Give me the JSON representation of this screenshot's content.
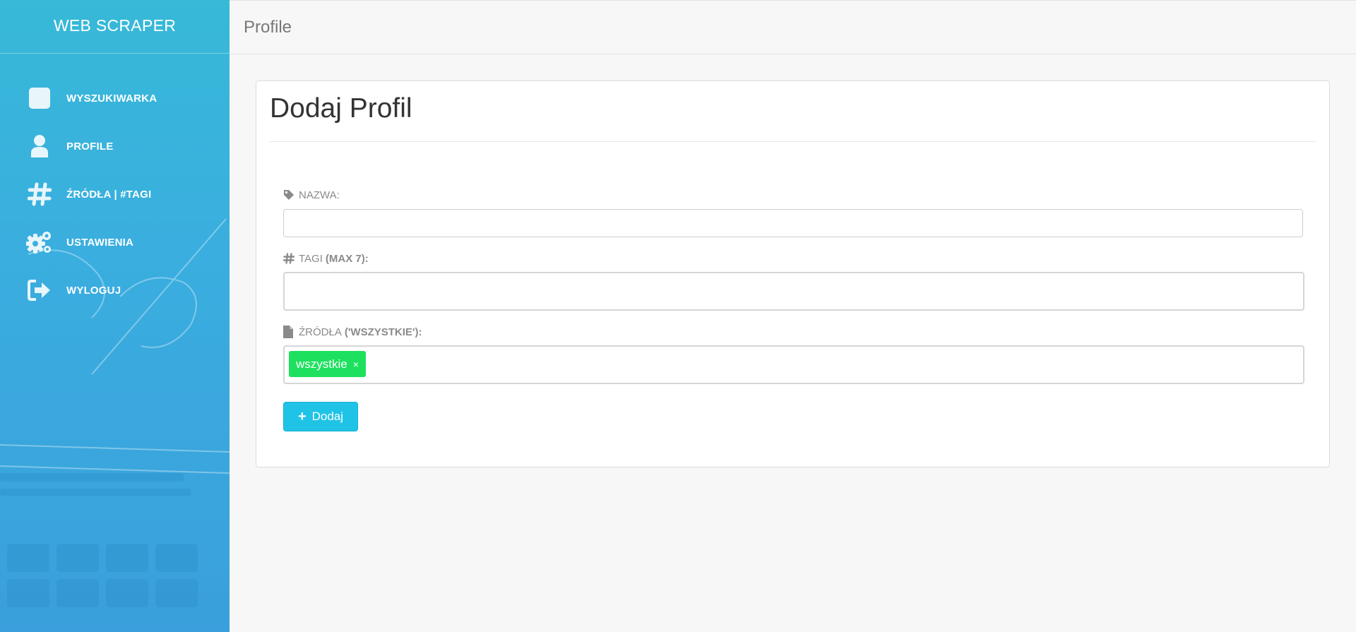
{
  "sidebar": {
    "brand": "WEB SCRAPER",
    "items": [
      {
        "label": "WYSZUKIWARKA",
        "icon": "square-icon"
      },
      {
        "label": "PROFILE",
        "icon": "user-icon"
      },
      {
        "label": "ŹRÓDŁA | #TAGI",
        "icon": "hash-icon"
      },
      {
        "label": "USTAWIENIA",
        "icon": "gears-icon"
      },
      {
        "label": "WYLOGUJ",
        "icon": "logout-icon"
      }
    ]
  },
  "header": {
    "title": "Profile"
  },
  "card": {
    "title": "Dodaj Profil",
    "fields": {
      "name": {
        "label": "NAZWA:",
        "icon": "tag-icon",
        "value": ""
      },
      "tags": {
        "label": "TAGI",
        "label_bold": "(MAX 7):",
        "icon": "hash-icon",
        "value": ""
      },
      "sources": {
        "label": "ŹRÓDŁA",
        "label_bold": "('WSZYSTKIE'):",
        "icon": "file-icon",
        "chips": [
          "wszystkie"
        ],
        "chip_remove": "×"
      }
    },
    "submit": {
      "icon": "+",
      "label": "Dodaj"
    }
  },
  "colors": {
    "sidebar": "#3aaedf",
    "chip": "#1de15e",
    "button": "#1fc3e6"
  }
}
